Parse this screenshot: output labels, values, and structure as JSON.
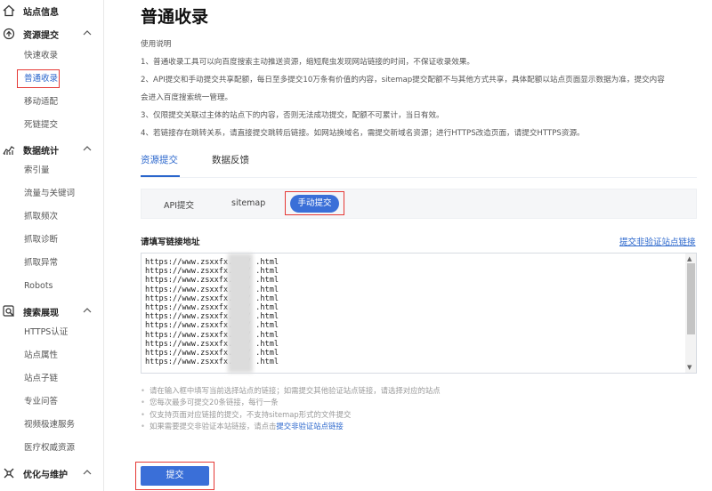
{
  "sidebar": {
    "groups": [
      {
        "label": "站点信息",
        "icon": "home-icon"
      },
      {
        "label": "资源提交",
        "icon": "submit-icon"
      },
      {
        "label": "数据统计",
        "icon": "chart-icon"
      },
      {
        "label": "搜索展现",
        "icon": "search-display-icon"
      },
      {
        "label": "优化与维护",
        "icon": "settings-icon"
      }
    ],
    "items": [
      {
        "label": "快速收录"
      },
      {
        "label": "普通收录"
      },
      {
        "label": "移动适配"
      },
      {
        "label": "死链提交"
      },
      {
        "label": "索引量"
      },
      {
        "label": "流量与关键词"
      },
      {
        "label": "抓取频次"
      },
      {
        "label": "抓取诊断"
      },
      {
        "label": "抓取异常"
      },
      {
        "label": "Robots"
      },
      {
        "label": "HTTPS认证"
      },
      {
        "label": "站点属性"
      },
      {
        "label": "站点子链"
      },
      {
        "label": "专业问答"
      },
      {
        "label": "视频极速服务"
      },
      {
        "label": "医疗权威资源"
      }
    ]
  },
  "main": {
    "title": "普通收录",
    "instructions": [
      "使用说明",
      "1、普通收录工具可以向百度搜索主动推送资源，缩短爬虫发现网站链接的时间，不保证收录效果。",
      "2、API提交和手动提交共享配额，每日至多提交10万条有价值的内容，sitemap提交配额不与其他方式共享，具体配额以站点页面显示数据为准，提交内容",
      "会进入百度搜索统一管理。",
      "3、仅限提交关联过主体的站点下的内容，否则无法成功提交，配额不可累计，当日有效。",
      "4、若链接存在跳转关系，请直接提交跳转后链接。如网站换域名，需提交新域名资源；进行HTTPS改造页面，请提交HTTPS资源。"
    ],
    "tabs": [
      {
        "label": "资源提交"
      },
      {
        "label": "数据反馈"
      }
    ],
    "subtabs": [
      {
        "label": "API提交"
      },
      {
        "label": "sitemap"
      },
      {
        "label": "手动提交"
      }
    ],
    "field_label": "请填写链接地址",
    "field_link": "提交非验证站点链接",
    "urls": [
      "https://www.zsxxfx.com/    .html",
      "https://www.zsxxfx.com/    .html",
      "https://www.zsxxfx.com/    .html",
      "https://www.zsxxfx.com/    .html",
      "https://www.zsxxfx.com/    .html",
      "https://www.zsxxfx.com/    .html",
      "https://www.zsxxfx.com/    .html",
      "https://www.zsxxfx.com/    .html",
      "https://www.zsxxfx.com/    .html",
      "https://www.zsxxfx.com/    .html",
      "https://www.zsxxfx.com/    .html",
      "https://www.zsxxfx.com/    .html"
    ],
    "tips": [
      "请在输入框中填写当前选择站点的链接；如需提交其他验证站点链接，请选择对应的站点",
      "您每次最多可提交20条链接，每行一条",
      "仅支持页面对应链接的提交，不支持sitemap形式的文件提交"
    ],
    "tip_last_prefix": "如果需要提交非验证本站链接，请点击",
    "tip_last_link": "提交非验证站点链接",
    "submit_label": "提交"
  },
  "colors": {
    "accent": "#3a6fd8",
    "link": "#2a66cc",
    "highlight_box": "#e53935"
  }
}
